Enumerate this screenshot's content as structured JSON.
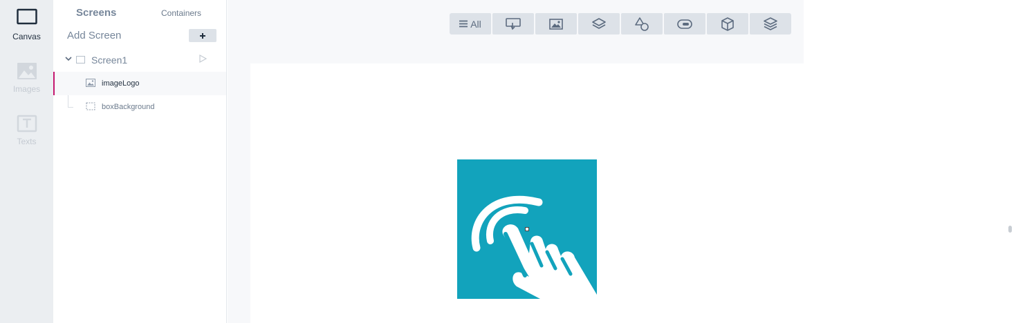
{
  "rail": {
    "canvas_label": "Canvas",
    "images_label": "Images",
    "texts_label": "Texts"
  },
  "panel": {
    "tab_screens": "Screens",
    "tab_containers": "Containers",
    "add_screen_label": "Add Screen",
    "screen_name": "Screen1",
    "layers": [
      "imageLogo",
      "boxBackground"
    ]
  },
  "toolbar": {
    "all_label": "All"
  },
  "colors": {
    "accent": "#c4176e",
    "logo_bg": "#12a3bc"
  }
}
